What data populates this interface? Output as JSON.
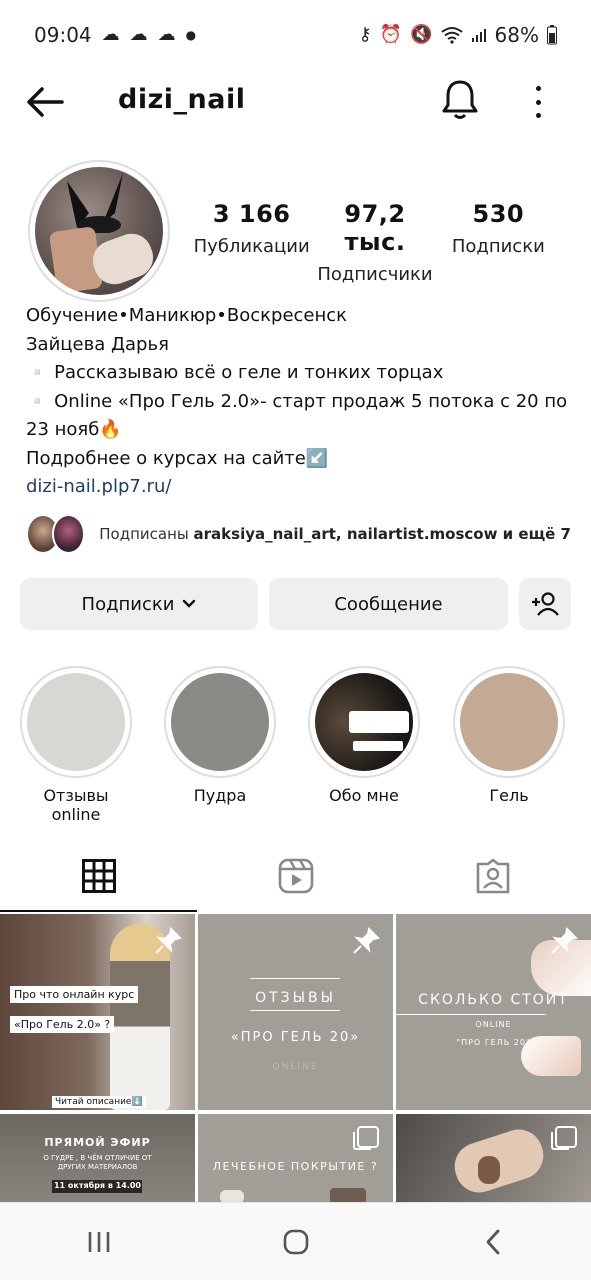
{
  "status_bar": {
    "time": "09:04",
    "battery": "68%"
  },
  "header": {
    "username": "dizi_nail"
  },
  "stats": [
    {
      "value": "3 166",
      "label": "Публикации"
    },
    {
      "value": "97,2 тыс.",
      "label": "Подписчики"
    },
    {
      "value": "530",
      "label": "Подписки"
    }
  ],
  "bio": {
    "line1": "Обучение•Маникюр•Воскресенск",
    "line2": "Зайцева Дарья",
    "line3": "▫️ Рассказываю всё о геле и тонких торцах",
    "line4": "▫️ Online «Про Гель 2.0»- старт продаж 5 потока с 20 по 23 нояб🔥",
    "line5": "Подробнее о курсах на сайте↙️",
    "link": "dizi-nail.plp7.ru/"
  },
  "followed_by": {
    "prefix": "Подписаны ",
    "accounts": "araksiya_nail_art, nailartist.moscow",
    "suffix": " и ещё 7"
  },
  "actions": {
    "following_label": "Подписки",
    "message_label": "Сообщение"
  },
  "highlights": [
    {
      "label": "Отзывы online",
      "color": "#d9d7d4"
    },
    {
      "label": "Пудра",
      "color": "#8c8a86"
    },
    {
      "label": "Обо мне",
      "color": "#1a1715"
    },
    {
      "label": "Гель",
      "color": "#c2aa95"
    }
  ],
  "posts": [
    {
      "caption1": "Про что онлайн курс",
      "caption2": "«Про Гель 2.0» ?",
      "footer": "Читай описание⬇️"
    },
    {
      "title": "ОТЗЫВЫ",
      "subtitle": "«ПРО ГЕЛЬ 20»",
      "small": "ONLINE"
    },
    {
      "title": "СКОЛЬКО СТОИТ",
      "small": "ONLINE",
      "subtitle": "\"ПРО ГЕЛЬ 20\""
    },
    {
      "title": "ПРЯМОЙ ЭФИР",
      "subtitle": "О ГУДРЕ , В ЧЁМ ОТЛИЧИЕ ОТ ДРУГИХ МАТЕРИАЛОВ",
      "date": "11 октября в 14.00"
    },
    {
      "title": "ЛЕЧЕБНОЕ ПОКРЫТИЕ ?"
    },
    {}
  ],
  "colors": {
    "button_bg": "#efefef",
    "link": "#1f3f6b",
    "post_gray": "#a19d97"
  }
}
